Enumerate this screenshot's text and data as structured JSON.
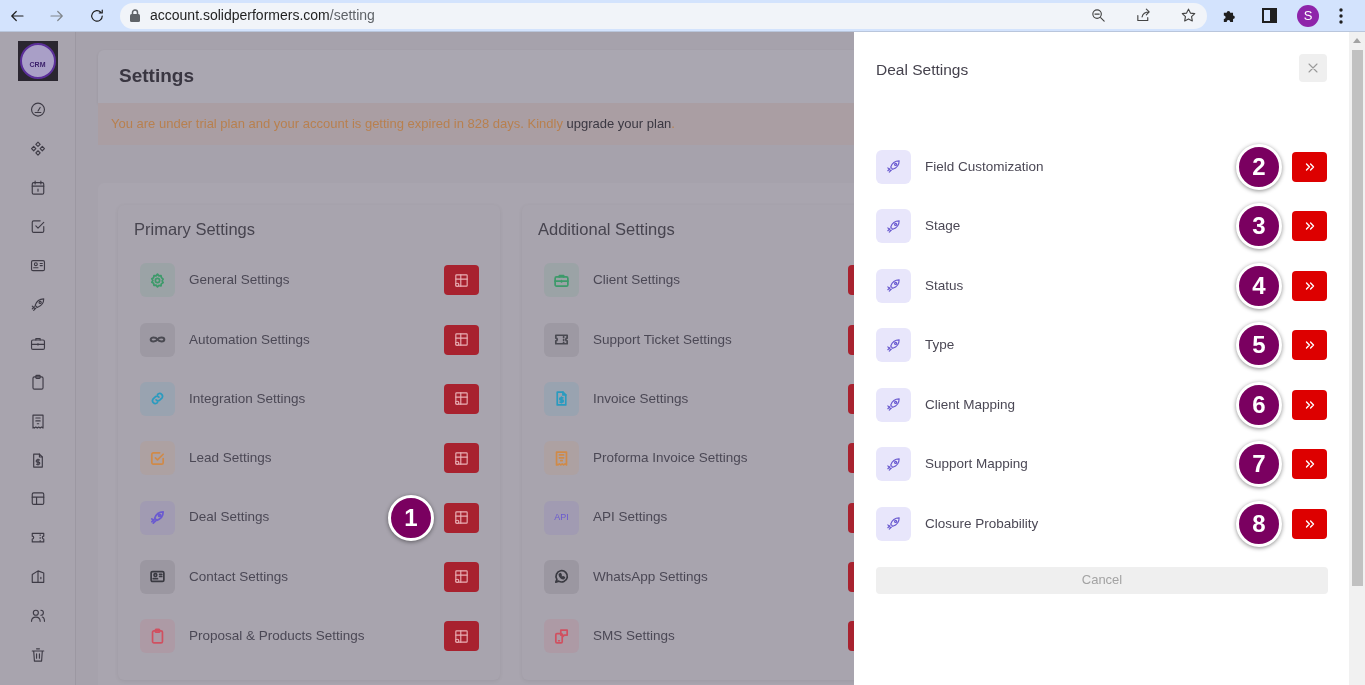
{
  "browser": {
    "url_host": "account.solidperformers.com",
    "url_path": "/setting",
    "profile_initial": "S"
  },
  "logo": {
    "text": "CRM"
  },
  "page": {
    "title": "Settings",
    "alert": {
      "text": "You are under trial plan and your account is getting expired in 828 days. Kindly",
      "link": "upgrade your plan",
      "tail": "."
    }
  },
  "sections": [
    {
      "title": "Primary Settings",
      "items": [
        {
          "label": "General Settings",
          "kind": "icon",
          "color": "#3d9a6a"
        },
        {
          "label": "Automation Settings",
          "kind": "icon",
          "color": "#4a4a52"
        },
        {
          "label": "Integration Settings",
          "kind": "icon",
          "color": "#2a9bbf"
        },
        {
          "label": "Lead Settings",
          "kind": "icon",
          "color": "#d08a48"
        },
        {
          "label": "Deal Settings",
          "kind": "icon",
          "color": "#6a5ad0",
          "step": "1"
        },
        {
          "label": "Contact Settings",
          "kind": "icon",
          "color": "#3a3a42"
        },
        {
          "label": "Proposal & Products Settings",
          "kind": "icon",
          "color": "#d05060"
        }
      ]
    },
    {
      "title": "Additional Settings",
      "items": [
        {
          "label": "Client Settings",
          "kind": "icon",
          "color": "#3d9a6a"
        },
        {
          "label": "Support Ticket Settings",
          "kind": "icon",
          "color": "#4a4a52"
        },
        {
          "label": "Invoice Settings",
          "kind": "icon",
          "color": "#2a9bbf"
        },
        {
          "label": "Proforma Invoice Settings",
          "kind": "icon",
          "color": "#d08a48"
        },
        {
          "label": "API Settings",
          "kind": "text",
          "icon_text": "API",
          "color": "#6a5ad0"
        },
        {
          "label": "WhatsApp Settings",
          "kind": "icon",
          "color": "#3a3a42"
        },
        {
          "label": "SMS Settings",
          "kind": "icon",
          "color": "#d05060"
        }
      ]
    }
  ],
  "drawer": {
    "title": "Deal Settings",
    "items": [
      {
        "label": "Field Customization",
        "step": "2"
      },
      {
        "label": "Stage",
        "step": "3"
      },
      {
        "label": "Status",
        "step": "4"
      },
      {
        "label": "Type",
        "step": "5"
      },
      {
        "label": "Client Mapping",
        "step": "6"
      },
      {
        "label": "Support Mapping",
        "step": "7"
      },
      {
        "label": "Closure Probability",
        "step": "8"
      }
    ],
    "cancel": "Cancel"
  }
}
